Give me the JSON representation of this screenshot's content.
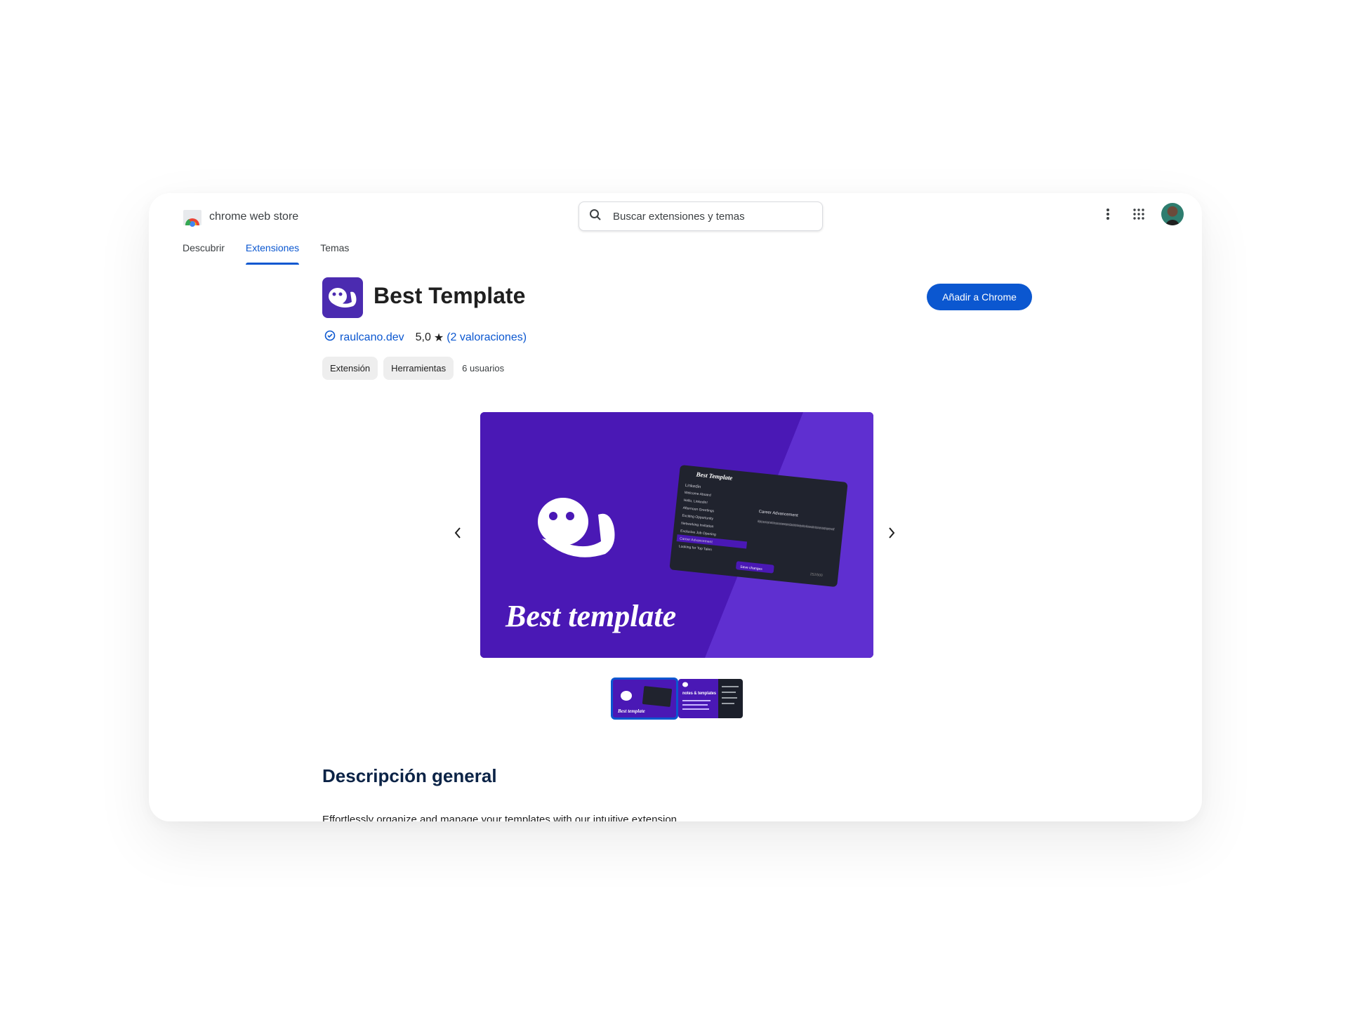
{
  "store": {
    "name": "chrome web store"
  },
  "search": {
    "placeholder": "Buscar extensiones y temas"
  },
  "tabs": [
    {
      "label": "Descubrir",
      "active": false
    },
    {
      "label": "Extensiones",
      "active": true
    },
    {
      "label": "Temas",
      "active": false
    }
  ],
  "extension": {
    "title": "Best Template",
    "developer": "raulcano.dev",
    "rating": "5,0",
    "star": "★",
    "reviews_open": "(",
    "reviews_link": "2 valoraciones",
    "reviews_close": ")",
    "chips": [
      "Extensión",
      "Herramientas"
    ],
    "users": "6 usuarios",
    "add_button": "Añadir a Chrome"
  },
  "hero": {
    "caption": "Best template",
    "mock_title": "Best Template",
    "mock_tab": "Linkedin",
    "mock_items": [
      "Welcome Aboard",
      "Hello, Linkedin!",
      "Afternoon Greetings",
      "Exciting Opportunity",
      "Networking Invitation",
      "Exclusive Job Opening",
      "Career Advancement",
      "Looking for Top Talen"
    ],
    "mock_active_index": 6,
    "mock_heading": "Career Advancement",
    "mock_body": "Hello [Name], I hope you're doing well. I wanted to inform you about a career advancement opportunity at [Company Name] that I believe aligns well with your skills and career aspirations. Would you be open to discussing this opportunity in more detail?",
    "mock_save": "Save changes",
    "mock_counter": "252/500"
  },
  "thumbnails": [
    {
      "caption": "Best template",
      "selected": true
    },
    {
      "caption": "notes & templates",
      "selected": false
    }
  ],
  "overview": {
    "title": "Descripción general",
    "text": "Effortlessly organize and manage your templates with our intuitive extension."
  },
  "colors": {
    "accent": "#0b57d0",
    "brand_purple": "#4a18b5",
    "heading": "#0b2346"
  }
}
